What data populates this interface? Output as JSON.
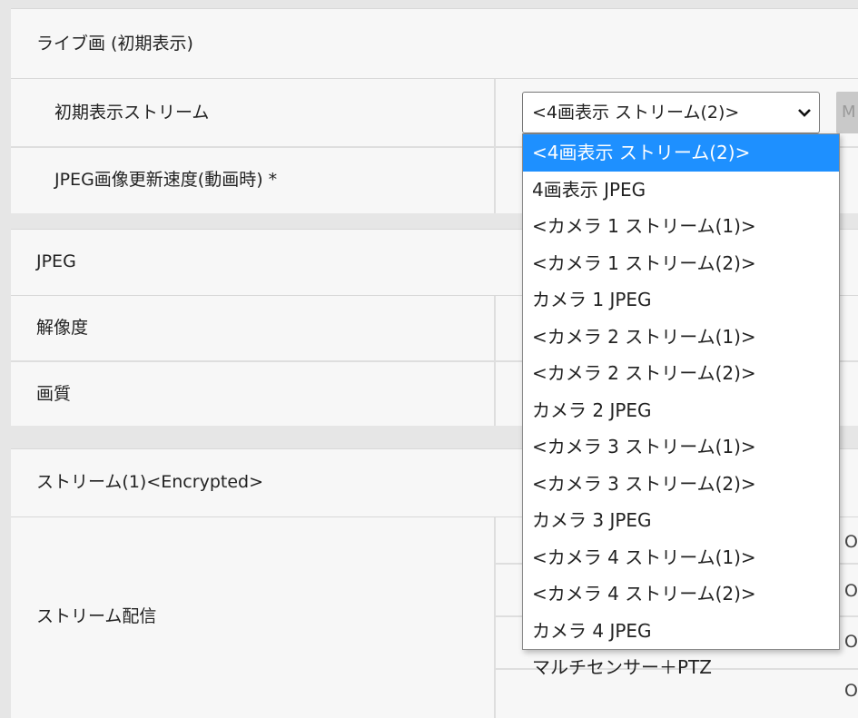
{
  "sections": {
    "live": {
      "title": "ライブ画 (初期表示)",
      "rows": [
        {
          "label": "初期表示ストリーム"
        },
        {
          "label": "JPEG画像更新速度(動画時) *"
        }
      ]
    },
    "jpeg": {
      "title": "JPEG",
      "rows": [
        {
          "label": "解像度"
        },
        {
          "label": "画質"
        }
      ]
    },
    "stream1": {
      "title": "ストリーム(1)<Encrypted>",
      "rows": [
        {
          "label": "ストリーム配信"
        }
      ]
    }
  },
  "select": {
    "value": "<4画表示 ストリーム(2)>",
    "button_label": "M",
    "options": [
      "<4画表示 ストリーム(2)>",
      "4画表示 JPEG",
      "<カメラ 1 ストリーム(1)>",
      "<カメラ 1 ストリーム(2)>",
      "カメラ 1 JPEG",
      "<カメラ 2 ストリーム(1)>",
      "<カメラ 2 ストリーム(2)>",
      "カメラ 2 JPEG",
      "<カメラ 3 ストリーム(1)>",
      "<カメラ 3 ストリーム(2)>",
      "カメラ 3 JPEG",
      "<カメラ 4 ストリーム(1)>",
      "<カメラ 4 ストリーム(2)>",
      "カメラ 4 JPEG",
      "マルチセンサー＋PTZ"
    ],
    "selected_index": 0
  },
  "right_clipped": {
    "char": "O"
  }
}
